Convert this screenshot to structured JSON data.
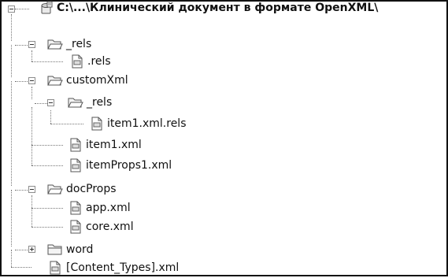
{
  "tree": {
    "root": {
      "label": "C:\\...\\Клинический документ в формате OpenXML\\"
    },
    "rels_folder": {
      "label": "_rels"
    },
    "rels_file": {
      "label": ".rels"
    },
    "customxml_folder": {
      "label": "customXml"
    },
    "customxml_rels_folder": {
      "label": "_rels"
    },
    "item1_rels_file": {
      "label": "item1.xml.rels"
    },
    "item1_file": {
      "label": "item1.xml"
    },
    "itemprops1_file": {
      "label": "itemProps1.xml"
    },
    "docprops_folder": {
      "label": "docProps"
    },
    "app_file": {
      "label": "app.xml"
    },
    "core_file": {
      "label": "core.xml"
    },
    "word_folder": {
      "label": "word"
    },
    "content_types_file": {
      "label": "[Content_Types].xml"
    }
  },
  "icons": {
    "root": "database-icon",
    "folder_open": "folder-open-icon",
    "folder_closed": "folder-icon",
    "file": "xml-file-icon"
  },
  "colors": {
    "border": "#111111",
    "connector": "#777777"
  }
}
